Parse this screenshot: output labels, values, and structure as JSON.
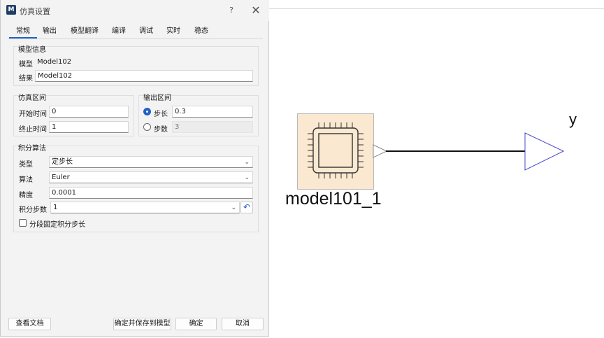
{
  "dialog": {
    "title": "仿真设置",
    "help": "?",
    "close": "✕",
    "tabs": [
      "常规",
      "输出",
      "模型翻译",
      "编译",
      "调试",
      "实时",
      "稳态"
    ],
    "model_info": {
      "title": "模型信息",
      "model_label": "模型",
      "model_value": "Model102",
      "result_label": "结果",
      "result_value": "Model102"
    },
    "sim_interval": {
      "title": "仿真区间",
      "start_label": "开始时间",
      "start_value": "0",
      "stop_label": "终止时间",
      "stop_value": "1"
    },
    "output_interval": {
      "title": "输出区间",
      "step_label": "步长",
      "step_value": "0.3",
      "step_selected": true,
      "count_label": "步数",
      "count_value": "3"
    },
    "integration": {
      "title": "积分算法",
      "type_label": "类型",
      "type_value": "定步长",
      "algo_label": "算法",
      "algo_value": "Euler",
      "precision_label": "精度",
      "precision_value": "0.0001",
      "steps_label": "积分步数",
      "steps_value": "1",
      "segment_label": "分段固定积分步长",
      "segment_checked": false
    },
    "buttons": {
      "docs": "查看文档",
      "save_to_model": "确定并保存到模型",
      "ok": "确定",
      "cancel": "取消"
    }
  },
  "canvas": {
    "block_label": "model101_1",
    "output_label": "y",
    "block_color": "#fbe8d0",
    "outport_color": "#4a4ac8"
  },
  "colors": {
    "accent": "#1e63c6"
  }
}
